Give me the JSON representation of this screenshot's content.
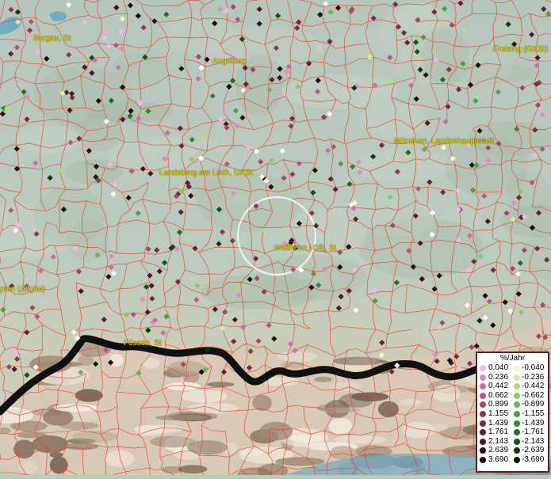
{
  "map": {
    "places": [
      {
        "name": "Burgau, St",
        "id": "burgau"
      },
      {
        "name": "Augsburg",
        "id": "augsburg"
      },
      {
        "name": "Freising (GKSt)",
        "id": "freising"
      },
      {
        "name": "München, Landeshauptstadt",
        "id": "muenchen"
      },
      {
        "name": "Landsberg am Lech, GKSt",
        "id": "landsberg"
      },
      {
        "name": "Weilheim i.OB, St",
        "id": "weilheim"
      },
      {
        "name": "pten (Allgäu)",
        "id": "kempten"
      },
      {
        "name": "Füssen, St",
        "id": "fuessen"
      }
    ],
    "boundary_color": "#e8402a",
    "border_color": "#111111"
  },
  "legend": {
    "title": "%/Jahr",
    "positive": [
      {
        "label": "0.040",
        "color": "#f2b8e6"
      },
      {
        "label": "0.236",
        "color": "#e08cc4"
      },
      {
        "label": "0.442",
        "color": "#cc6fa6"
      },
      {
        "label": "0.662",
        "color": "#b4587e"
      },
      {
        "label": "0.899",
        "color": "#a2486a"
      },
      {
        "label": "1.155",
        "color": "#8e3a52"
      },
      {
        "label": "1.439",
        "color": "#7a2a40"
      },
      {
        "label": "1.761",
        "color": "#661e30"
      },
      {
        "label": "2.143",
        "color": "#521420"
      },
      {
        "label": "2.639",
        "color": "#3a0a12"
      },
      {
        "label": "3.690",
        "color": "#240408"
      }
    ],
    "negative": [
      {
        "label": "-0.040",
        "color": "#f4f8c8"
      },
      {
        "label": "-0.236",
        "color": "#d4ec9e"
      },
      {
        "label": "-0.442",
        "color": "#b2dc82"
      },
      {
        "label": "-0.662",
        "color": "#8cc86a"
      },
      {
        "label": "-0.899",
        "color": "#6cb458"
      },
      {
        "label": "-1.155",
        "color": "#4e9e44"
      },
      {
        "label": "-1.439",
        "color": "#348834"
      },
      {
        "label": "-1.761",
        "color": "#1e7024"
      },
      {
        "label": "-2.143",
        "color": "#0e5416"
      },
      {
        "label": "-2.639",
        "color": "#063a0c"
      },
      {
        "label": "-3.690",
        "color": "#021e04"
      }
    ]
  }
}
